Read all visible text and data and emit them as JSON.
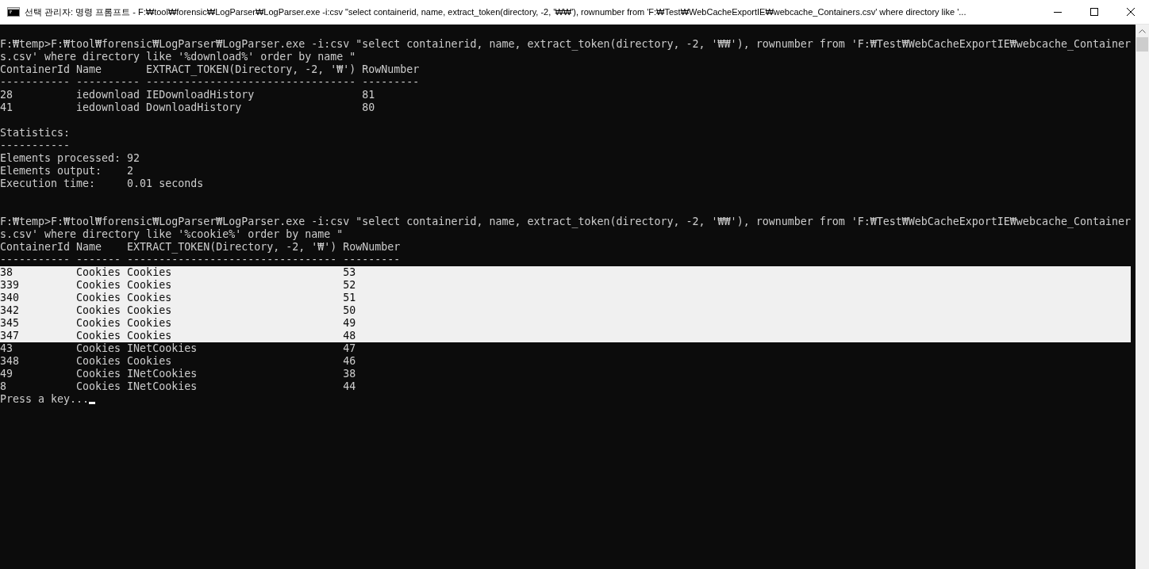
{
  "window": {
    "title": "선택 관리자: 명령 프롬프트 - F:₩tool₩forensic₩LogParser₩LogParser.exe  -i:csv \"select containerid, name, extract_token(directory, -2, '₩₩'), rownumber from 'F:₩Test₩WebCacheExportIE₩webcache_Containers.csv' where directory like '..."
  },
  "lines": [
    {
      "kind": "text",
      "selected": false,
      "text": "F:₩temp>F:₩tool₩forensic₩LogParser₩LogParser.exe -i:csv \"select containerid, name, extract_token(directory, -2, '₩₩'), rownumber from 'F:₩Test₩WebCacheExportIE₩webcache_Container"
    },
    {
      "kind": "text",
      "selected": false,
      "text": "s.csv' where directory like '%download%' order by name \""
    },
    {
      "kind": "text",
      "selected": false,
      "text": "ContainerId Name       EXTRACT_TOKEN(Directory, -2, '₩') RowNumber"
    },
    {
      "kind": "text",
      "selected": false,
      "text": "----------- ---------- --------------------------------- ---------"
    },
    {
      "kind": "text",
      "selected": false,
      "text": "28          iedownload IEDownloadHistory                 81"
    },
    {
      "kind": "text",
      "selected": false,
      "text": "41          iedownload DownloadHistory                   80"
    },
    {
      "kind": "blank"
    },
    {
      "kind": "text",
      "selected": false,
      "text": "Statistics:"
    },
    {
      "kind": "text",
      "selected": false,
      "text": "-----------"
    },
    {
      "kind": "text",
      "selected": false,
      "text": "Elements processed: 92"
    },
    {
      "kind": "text",
      "selected": false,
      "text": "Elements output:    2"
    },
    {
      "kind": "text",
      "selected": false,
      "text": "Execution time:     0.01 seconds"
    },
    {
      "kind": "blank"
    },
    {
      "kind": "blank"
    },
    {
      "kind": "text",
      "selected": false,
      "text": "F:₩temp>F:₩tool₩forensic₩LogParser₩LogParser.exe -i:csv \"select containerid, name, extract_token(directory, -2, '₩₩'), rownumber from 'F:₩Test₩WebCacheExportIE₩webcache_Container"
    },
    {
      "kind": "text",
      "selected": false,
      "text": "s.csv' where directory like '%cookie%' order by name \""
    },
    {
      "kind": "text",
      "selected": false,
      "text": "ContainerId Name    EXTRACT_TOKEN(Directory, -2, '₩') RowNumber"
    },
    {
      "kind": "text",
      "selected": false,
      "text": "----------- ------- --------------------------------- ---------"
    },
    {
      "kind": "text",
      "selected": true,
      "text": "38          Cookies Cookies                           53"
    },
    {
      "kind": "text",
      "selected": true,
      "text": "339         Cookies Cookies                           52"
    },
    {
      "kind": "text",
      "selected": true,
      "text": "340         Cookies Cookies                           51"
    },
    {
      "kind": "text",
      "selected": true,
      "text": "342         Cookies Cookies                           50"
    },
    {
      "kind": "text",
      "selected": true,
      "text": "345         Cookies Cookies                           49"
    },
    {
      "kind": "text",
      "selected": true,
      "text": "347         Cookies Cookies                           48"
    },
    {
      "kind": "text",
      "selected": false,
      "text": "43          Cookies INetCookies                       47"
    },
    {
      "kind": "text",
      "selected": false,
      "text": "348         Cookies Cookies                           46"
    },
    {
      "kind": "text",
      "selected": false,
      "text": "49          Cookies INetCookies                       38"
    },
    {
      "kind": "text",
      "selected": false,
      "text": "8           Cookies INetCookies                       44"
    },
    {
      "kind": "prompt",
      "selected": false,
      "text": "Press a key..."
    }
  ]
}
